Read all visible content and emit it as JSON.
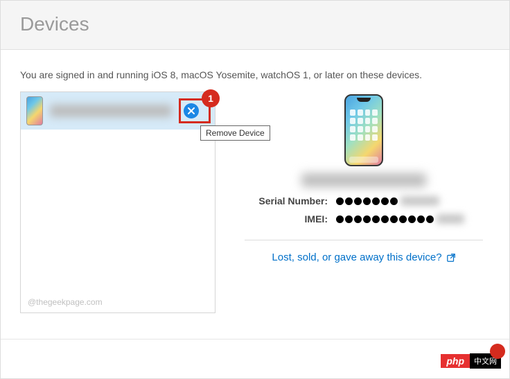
{
  "header": {
    "title": "Devices"
  },
  "intro": "You are signed in and running iOS 8, macOS Yosemite, watchOS 1, or later on these devices.",
  "callout": {
    "number": "1",
    "tooltip": "Remove Device"
  },
  "watermark": "@thegeekpage.com",
  "details": {
    "serial_label": "Serial Number:",
    "imei_label": "IMEI:",
    "lost_link": "Lost, sold, or gave away this device?"
  },
  "brand": {
    "left": "php",
    "right": "中文网"
  }
}
